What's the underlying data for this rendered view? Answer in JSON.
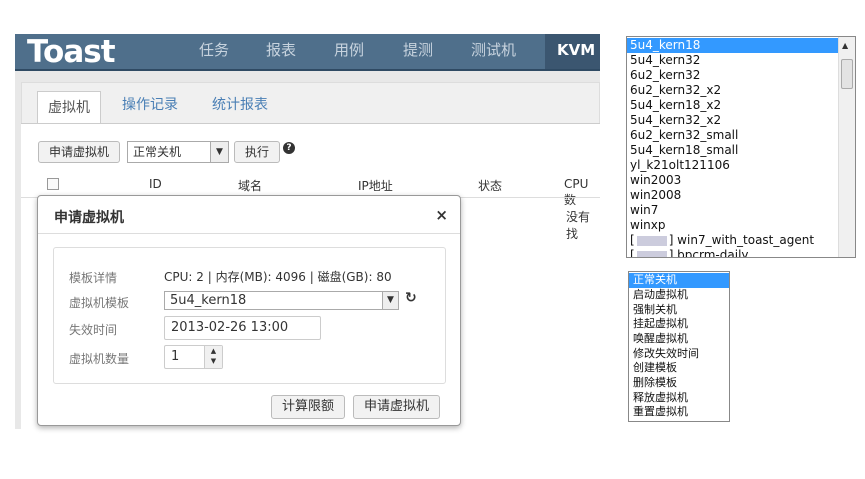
{
  "app": {
    "logo": "Toast",
    "nav": [
      "任务",
      "报表",
      "用例",
      "提测",
      "测试机",
      "KVM"
    ],
    "tabs": [
      "虚拟机",
      "操作记录",
      "统计报表"
    ],
    "toolbar": {
      "apply_button": "申请虚拟机",
      "action_select": "正常关机",
      "execute_button": "执行"
    },
    "table_headers": [
      "ID",
      "域名",
      "IP地址",
      "状态",
      "CPU数"
    ],
    "empty_text": "没有找"
  },
  "modal": {
    "title": "申请虚拟机",
    "close": "×",
    "fields": {
      "template_detail_label": "模板详情",
      "template_detail_value": "CPU: 2 | 内存(MB): 4096 | 磁盘(GB): 80",
      "template_label": "虚拟机模板",
      "template_value": "5u4_kern18",
      "expire_label": "失效时间",
      "expire_value": "2013-02-26 13:00",
      "count_label": "虚拟机数量",
      "count_value": "1"
    },
    "buttons": {
      "calc_quota": "计算限额",
      "apply": "申请虚拟机"
    }
  },
  "vm_templates": [
    "5u4_kern18",
    "5u4_kern32",
    "6u2_kern32",
    "6u2_kern32_x2",
    "5u4_kern18_x2",
    "5u4_kern32_x2",
    "6u2_kern32_small",
    "5u4_kern18_small",
    "yl_k21olt121106",
    "win2003",
    "win2008",
    "win7",
    "winxp"
  ],
  "vm_templates_partial": [
    {
      "prefix": "[",
      "suffix": "] win7_with_toast_agent"
    },
    {
      "prefix": "[",
      "suffix": "] bpcrm-daily"
    }
  ],
  "actions": [
    "正常关机",
    "启动虚拟机",
    "强制关机",
    "挂起虚拟机",
    "唤醒虚拟机",
    "修改失效时间",
    "创建模板",
    "删除模板",
    "释放虚拟机",
    "重置虚拟机"
  ],
  "colors": {
    "navbar": "#4f6f8b",
    "selection": "#3399ff",
    "tab_link": "#4a7fb5"
  }
}
